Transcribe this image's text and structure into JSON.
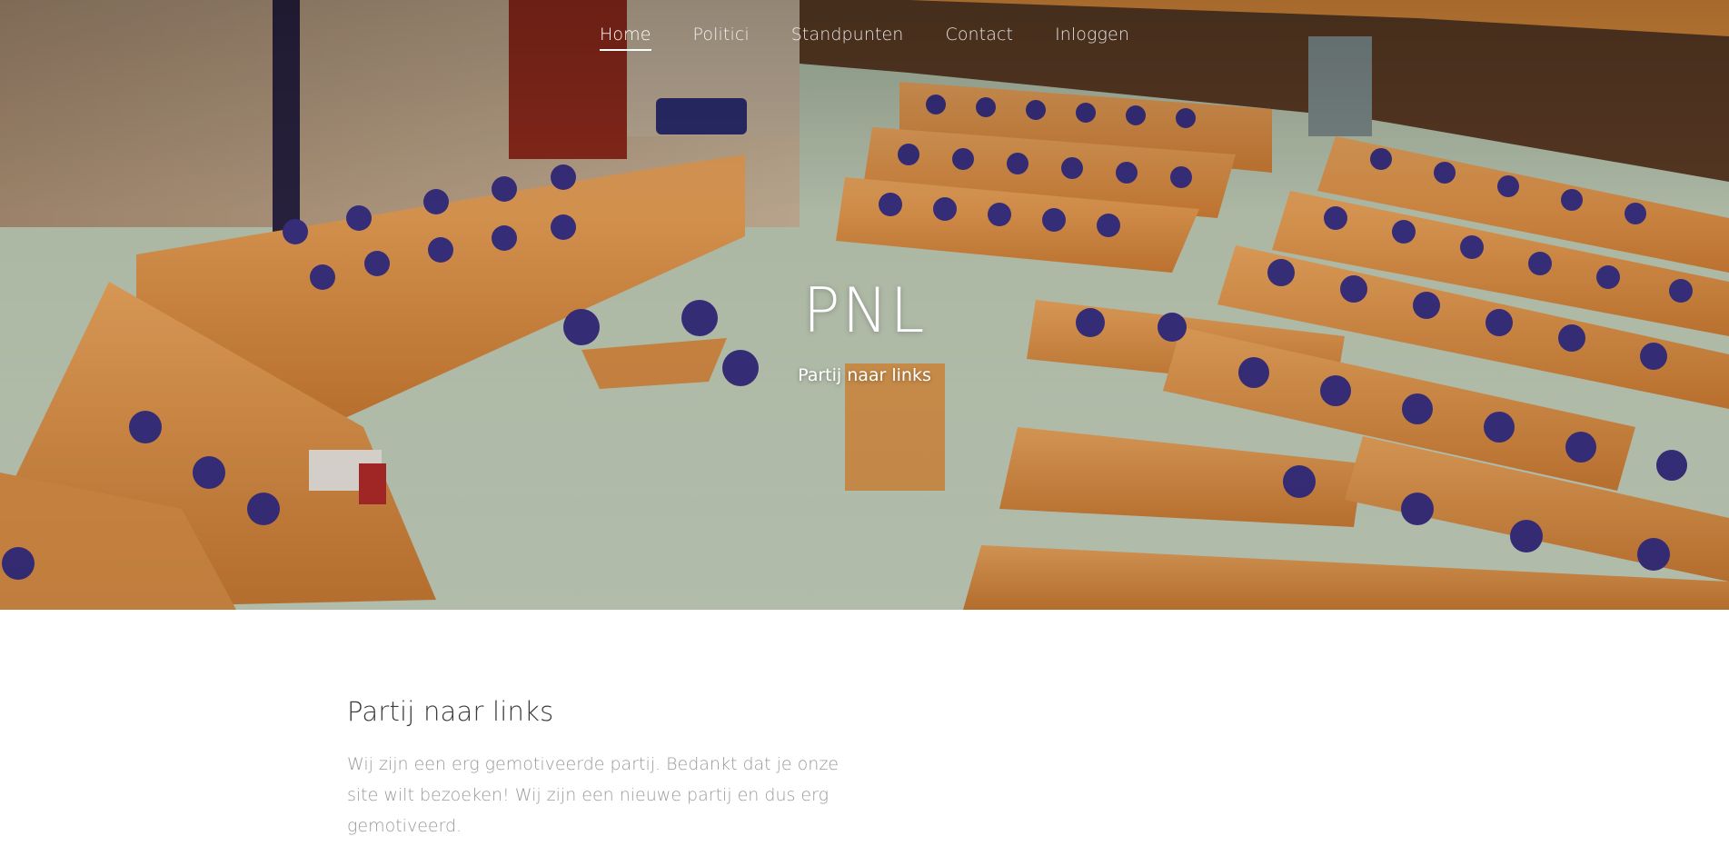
{
  "nav": {
    "items": [
      {
        "label": "Home",
        "active": true
      },
      {
        "label": "Politici",
        "active": false
      },
      {
        "label": "Standpunten",
        "active": false
      },
      {
        "label": "Contact",
        "active": false
      },
      {
        "label": "Inloggen",
        "active": false
      }
    ]
  },
  "hero": {
    "title": "PNL",
    "subtitle": "Partij naar links",
    "background": "parliament-chamber-photo"
  },
  "intro": {
    "heading": "Partij naar links",
    "text": "Wij zijn een erg gemotiveerde partij. Bedankt dat je onze site wilt bezoeken! Wij zijn een nieuwe partij en dus erg gemotiveerd."
  },
  "colors": {
    "nav_text": "#ffffff",
    "heading": "#3a3a3a",
    "body_text": "#9a9a9a"
  }
}
